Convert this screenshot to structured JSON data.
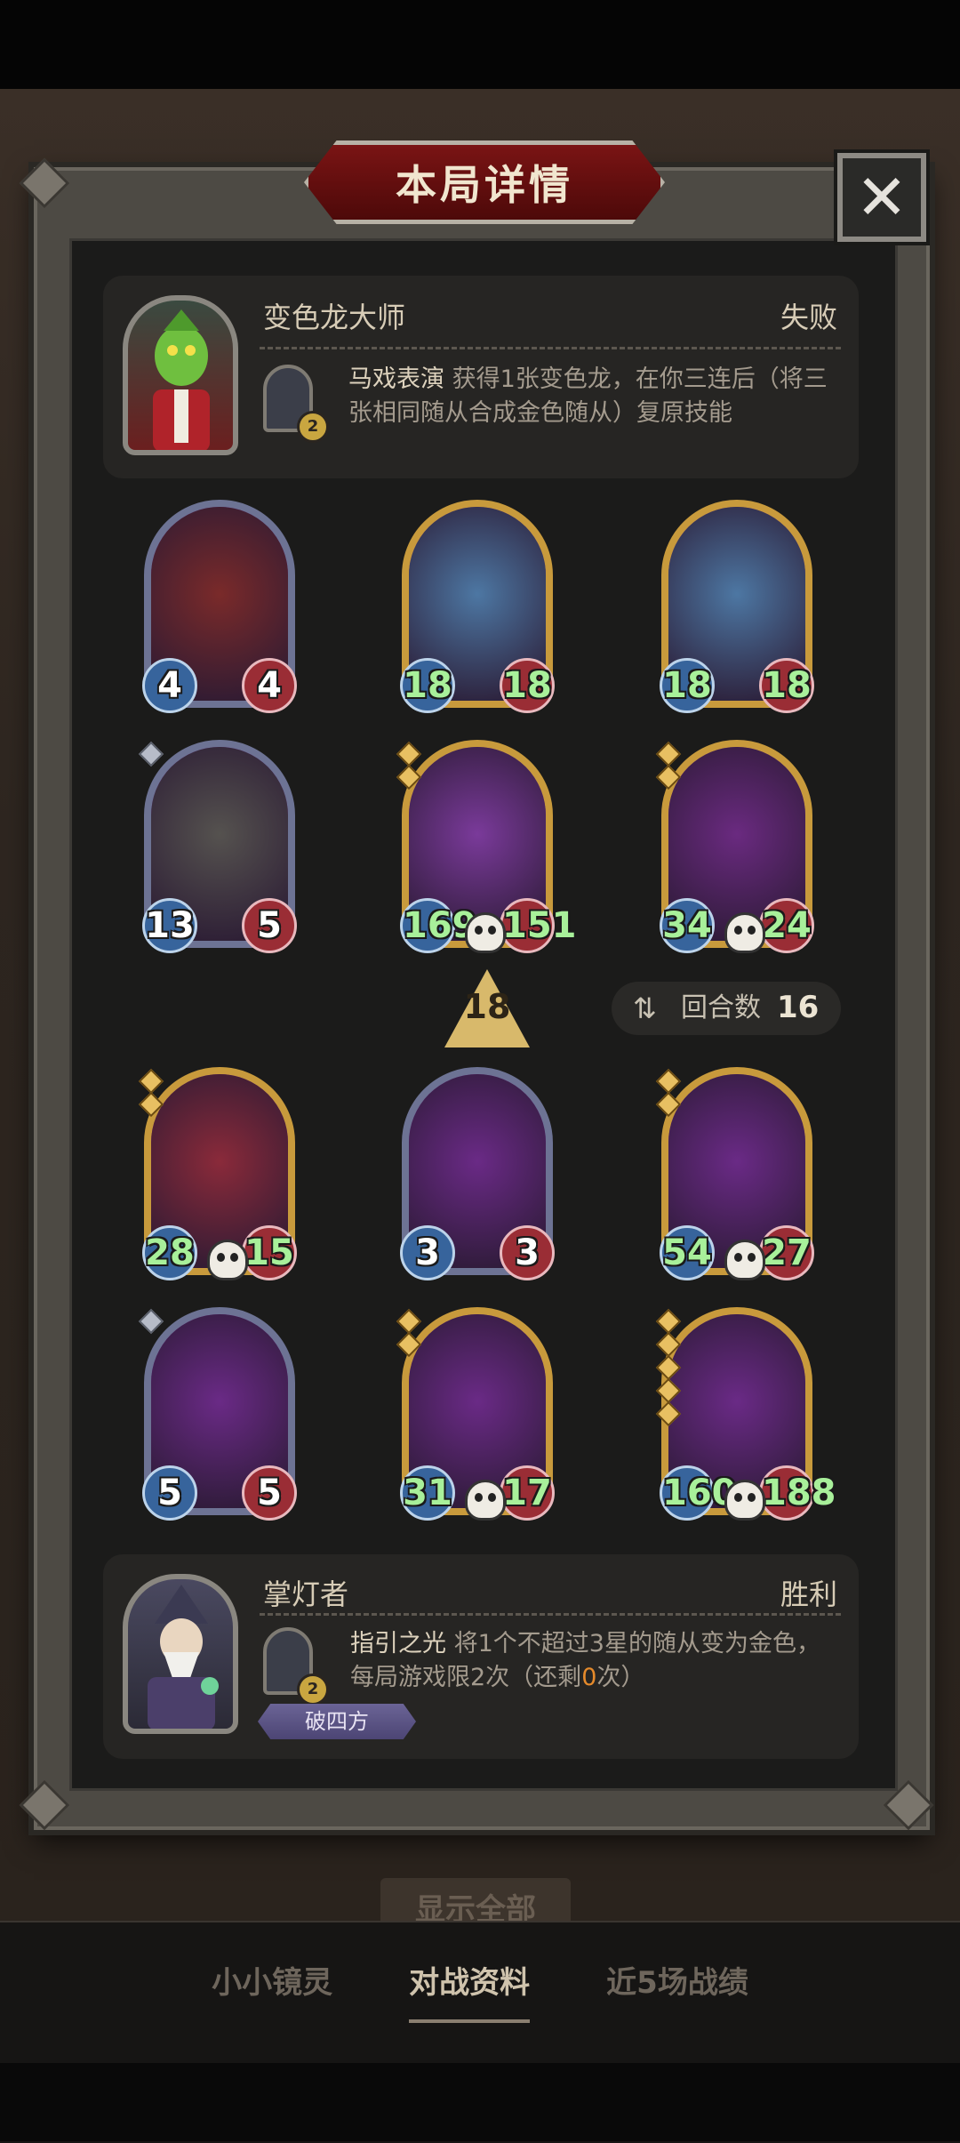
{
  "dialog": {
    "title": "本局详情",
    "close_icon": "✕"
  },
  "opponent": {
    "name": "变色龙大师",
    "result": "失败",
    "skill_level": "2",
    "skill_name": "马戏表演",
    "skill_desc": "获得1张变色龙，在你三连后（将三张相同随从合成金色随从）复原技能"
  },
  "opponent_board": [
    {
      "attack": "4",
      "health": "4",
      "frame": "silver",
      "golden": false,
      "skull": false,
      "stars": 0,
      "art_color": "#7a2a2a"
    },
    {
      "attack": "18",
      "health": "18",
      "frame": "gold",
      "golden": true,
      "skull": false,
      "stars": 0,
      "art_color": "#4d77a3"
    },
    {
      "attack": "18",
      "health": "18",
      "frame": "gold",
      "golden": true,
      "skull": false,
      "stars": 0,
      "art_color": "#4d77a3"
    },
    {
      "attack": "13",
      "health": "5",
      "frame": "silver",
      "golden": false,
      "skull": false,
      "stars": 1,
      "art_color": "#55524f"
    },
    {
      "attack": "169",
      "health": "151",
      "frame": "gold",
      "golden": true,
      "skull": true,
      "stars": 2,
      "art_color": "#7a3a9a"
    },
    {
      "attack": "34",
      "health": "24",
      "frame": "gold",
      "golden": true,
      "skull": true,
      "stars": 2,
      "art_color": "#6a2a80"
    }
  ],
  "level_badge": "18",
  "round": {
    "label": "回合数",
    "value": "16"
  },
  "player_board": [
    {
      "attack": "28",
      "health": "15",
      "frame": "gold",
      "golden": true,
      "skull": true,
      "stars": 2,
      "art_color": "#8a2a3a"
    },
    {
      "attack": "3",
      "health": "3",
      "frame": "silver",
      "golden": false,
      "skull": false,
      "stars": 0,
      "art_color": "#6a2a86"
    },
    {
      "attack": "54",
      "health": "27",
      "frame": "gold",
      "golden": true,
      "skull": true,
      "stars": 2,
      "art_color": "#6a2a86"
    },
    {
      "attack": "5",
      "health": "5",
      "frame": "silver",
      "golden": false,
      "skull": false,
      "stars": 1,
      "art_color": "#6a2a86"
    },
    {
      "attack": "31",
      "health": "17",
      "frame": "gold",
      "golden": true,
      "skull": true,
      "stars": 2,
      "art_color": "#6a2a86"
    },
    {
      "attack": "160",
      "health": "188",
      "frame": "gold",
      "golden": true,
      "skull": true,
      "stars": 5,
      "art_color": "#6a2a86"
    }
  ],
  "player": {
    "name": "掌灯者",
    "result": "胜利",
    "skill_level": "2",
    "skill_name": "指引之光",
    "skill_desc_1": "将1个不超过3星的随从变为金色，每局游戏限2次（还剩",
    "skill_remaining": "0",
    "skill_desc_2": "次）",
    "tag": "破四方"
  },
  "behind": {
    "show_all": "显示全部"
  },
  "tabs": [
    {
      "label": "小小镜灵",
      "active": false
    },
    {
      "label": "对战资料",
      "active": true
    },
    {
      "label": "近5场战绩",
      "active": false
    }
  ]
}
